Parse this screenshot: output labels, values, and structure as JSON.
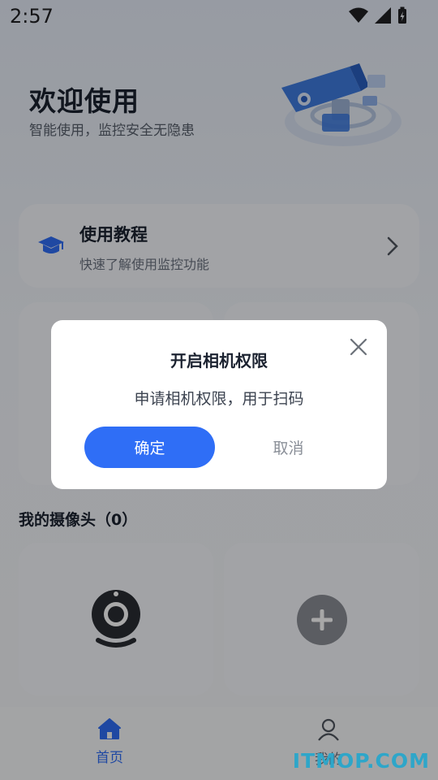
{
  "status_bar": {
    "time": "2:57",
    "icons": [
      "wifi-icon",
      "signal-icon",
      "battery-charging-icon"
    ]
  },
  "hero": {
    "title": "欢迎使用",
    "subtitle": "智能使用，监控安全无隐患"
  },
  "tutorial": {
    "title": "使用教程",
    "subtitle": "快速了解使用监控功能"
  },
  "cameras": {
    "section_title": "我的摄像头（0）"
  },
  "tabbar": {
    "home_label": "首页",
    "mine_label": "我的"
  },
  "dialog": {
    "title": "开启相机权限",
    "message": "申请相机权限，用于扫码",
    "confirm_label": "确定",
    "cancel_label": "取消"
  },
  "watermark": "ITMOP.COM",
  "colors": {
    "accent": "#2f6ef6",
    "background": "#eef2f7",
    "card": "#f6f8fc"
  }
}
